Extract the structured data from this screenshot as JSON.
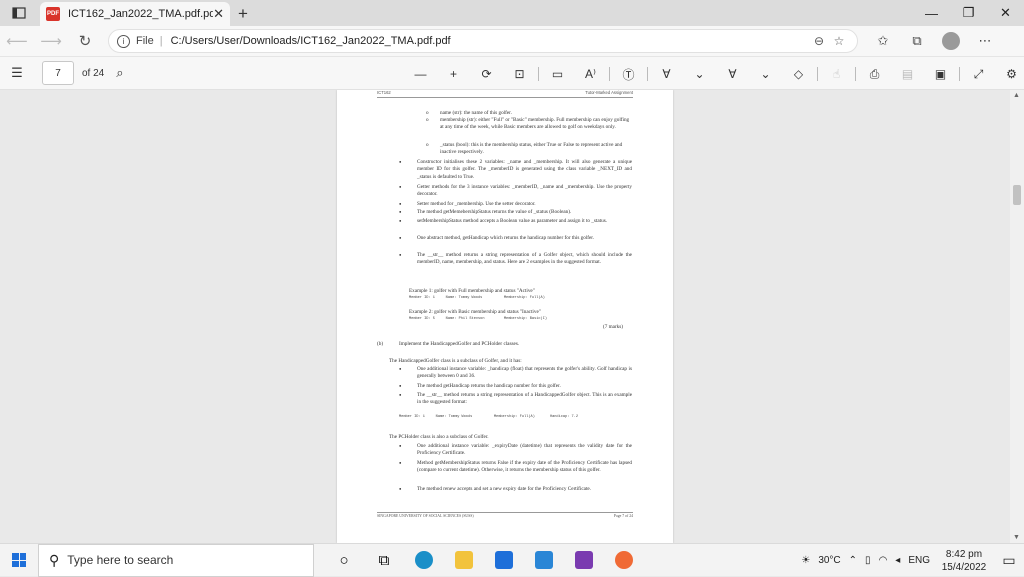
{
  "tab": {
    "title": "ICT162_Jan2022_TMA.pdf.pdf",
    "icon": "pdf-icon",
    "close": "✕",
    "new_tab": "+"
  },
  "window_controls": {
    "minimize": "—",
    "restore": "❐",
    "close": "✕"
  },
  "address": {
    "file_label": "File",
    "separator": "|",
    "url": "C:/Users/User/Downloads/ICT162_Jan2022_TMA.pdf.pdf"
  },
  "pdf_toolbar": {
    "page_input": "7",
    "page_count": "of 24"
  },
  "page": {
    "header_left": "ICT162",
    "header_right": "Tutor-Marked Assignment",
    "sub_items": [
      {
        "bullet": "o",
        "text": "name (str): the name of this golfer."
      },
      {
        "bullet": "o",
        "text": "membership (str): either \"Full\" or \"Basic\" membership. Full membership can enjoy golfing at any time of the week, while Basic members are allowed to golf on weekdays only."
      },
      {
        "bullet": "o",
        "text": "_status (bool): this is the membership status, either True or False to represent active and inactive respectively."
      }
    ],
    "bullets_a": [
      "Constructor initialises these 2 variables: _name and _membership. It will also generate a unique member ID for this golfer. The _memberID is generated using the class variable _NEXT_ID and _status is defaulted to True.",
      "Getter methods for the 3 instance variables: _memberID, _name and _membership. Use the property decorator.",
      "Setter method for _membership. Use the setter decorator.",
      "The method getMemebershipStatus returns the value of _status (Boolean).",
      "setMembershipStatus method accepts a Boolean value as parameter and assign it to _status.",
      "One abstract method, getHandicap which returns the handicap number for this golfer.",
      "The __str__ method returns a string representation of a Golfer object, which should include the memberID, name, membership, and status. Here are 2 examples in the suggested format."
    ],
    "example1_caption": "Example 1: golfer with Full membership and status \"Active\"",
    "example1_code": "Member ID: 1     Name: Tommy Woods          Membership: Full(A)",
    "example2_caption": "Example 2: golfer with Basic membership and status \"Inactive\"",
    "example2_code": "Member ID: 5     Name: Phil Stevson         Membership: Basic(I)",
    "marks": "(7 marks)",
    "part_b_label": "(b)",
    "part_b_text": "Implement the HandicappedGolfer and PCHolder classes.",
    "hg_intro": "The HandicappedGolfer class is a subclass of Golfer, and it has:",
    "bullets_b": [
      "One additional instance variable: _handicap (float) that represents the golfer's ability. Golf handicap is generally between 0 and 36.",
      "The method getHandicap returns the handicap number for this golfer.",
      "The __str__ method returns a string representation of a HandicappedGolfer object. This is an example in the suggested format:"
    ],
    "example3_code": "Member ID: 1     Name: Tommy Woods          Membership: Full(A)       Handicap: 7.2",
    "pc_intro": "The PCHolder class is also a subclass of Golfer.",
    "bullets_c": [
      "One additional instance variable: _expiryDate (datetime) that represents the validity date for the Proficiency Certificate.",
      "Method getMembershipStatus returns False if the expiry date of the Proficiency Certificate has lapsed (compare to current datetime). Otherwise, it returns the membership status of this golfer.",
      "The method renew accepts and set a new expiry date for the Proficiency Certificate."
    ],
    "footer_left": "SINGAPORE UNIVERSITY OF SOCIAL SCIENCES (SUSS)",
    "footer_right": "Page 7 of 24"
  },
  "taskbar": {
    "search_placeholder": "Type here to search",
    "weather": "30°C",
    "language": "ENG",
    "time": "8:42 pm",
    "date": "15/4/2022"
  },
  "colors": {
    "accent": "#1e6fd9",
    "pdf_red": "#d9342b",
    "chrome_bg": "#f7f7f7"
  }
}
